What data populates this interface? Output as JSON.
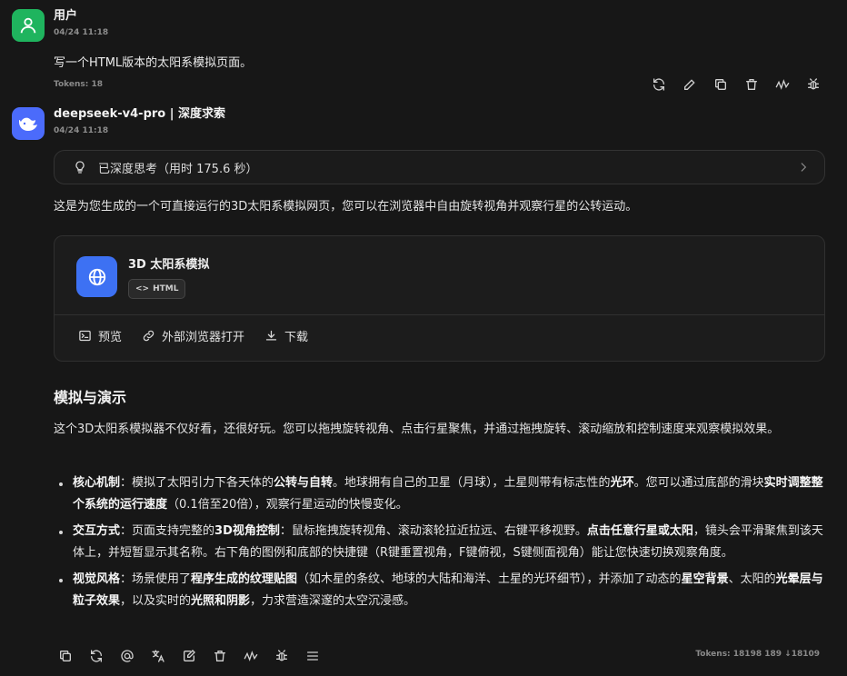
{
  "user_message": {
    "name": "用户",
    "time": "04/24 11:18",
    "text": "写一个HTML版本的太阳系模拟页面。",
    "tokens": "Tokens: 18",
    "actions": [
      "refresh-icon",
      "edit-icon",
      "copy-icon",
      "delete-icon",
      "wave-icon",
      "bug-icon"
    ]
  },
  "assistant_message": {
    "name": "deepseek-v4-pro | 深度求索",
    "time": "04/24 11:18",
    "thinking_label": "已深度思考（用时 175.6 秒）",
    "intro": "这是为您生成的一个可直接运行的3D太阳系模拟网页，您可以在浏览器中自由旋转视角并观察行星的公转运动。",
    "artifact": {
      "title": "3D 太阳系模拟",
      "tag": "HTML",
      "tag_symbol": "<>",
      "preview": "预览",
      "open_external": "外部浏览器打开",
      "download": "下载"
    },
    "section_title": "模拟与演示",
    "section_para": "这个3D太阳系模拟器不仅好看，还很好玩。您可以拖拽旋转视角、点击行星聚焦，并通过拖拽旋转、滚动缩放和控制速度来观察模拟效果。",
    "bullets": [
      {
        "segments": [
          {
            "t": "核心机制",
            "b": true
          },
          {
            "t": "：模拟了太阳引力下各天体的",
            "b": false
          },
          {
            "t": "公转与自转",
            "b": true
          },
          {
            "t": "。地球拥有自己的卫星（月球），土星则带有标志性的",
            "b": false
          },
          {
            "t": "光环",
            "b": true
          },
          {
            "t": "。您可以通过底部的滑块",
            "b": false
          },
          {
            "t": "实时调整整个系统的运行速度",
            "b": true
          },
          {
            "t": "（0.1倍至20倍），观察行星运动的快慢变化。",
            "b": false
          }
        ]
      },
      {
        "segments": [
          {
            "t": "交互方式",
            "b": true
          },
          {
            "t": "：页面支持完整的",
            "b": false
          },
          {
            "t": "3D视角控制",
            "b": true
          },
          {
            "t": "：鼠标拖拽旋转视角、滚动滚轮拉近拉远、右键平移视野。",
            "b": false
          },
          {
            "t": "点击任意行星或太阳",
            "b": true
          },
          {
            "t": "，镜头会平滑聚焦到该天体上，并短暂显示其名称。右下角的图例和底部的快捷键（R键重置视角，F键俯视，S键侧面视角）能让您快速切换观察角度。",
            "b": false
          }
        ]
      },
      {
        "segments": [
          {
            "t": "视觉风格",
            "b": true
          },
          {
            "t": "：场景使用了",
            "b": false
          },
          {
            "t": "程序生成的纹理贴图",
            "b": true
          },
          {
            "t": "（如木星的条纹、地球的大陆和海洋、土星的光环细节），并添加了动态的",
            "b": false
          },
          {
            "t": "星空背景",
            "b": true
          },
          {
            "t": "、太阳的",
            "b": false
          },
          {
            "t": "光晕层与粒子效果",
            "b": true
          },
          {
            "t": "，以及实时的",
            "b": false
          },
          {
            "t": "光照和阴影",
            "b": true
          },
          {
            "t": "，力求营造深邃的太空沉浸感。",
            "b": false
          }
        ]
      }
    ],
    "actions": [
      "copy-icon",
      "refresh-icon",
      "mention-icon",
      "translate-icon",
      "edit-note-icon",
      "delete-icon",
      "wave-icon",
      "bug-icon",
      "menu-icon"
    ],
    "tokens": "Tokens: 18198 189 ↓18109"
  },
  "colors": {
    "background": "#171717",
    "user_avatar": "#1fb45e",
    "bot_avatar": "#4b6bfb",
    "artifact_icon": "#3d71f3"
  }
}
